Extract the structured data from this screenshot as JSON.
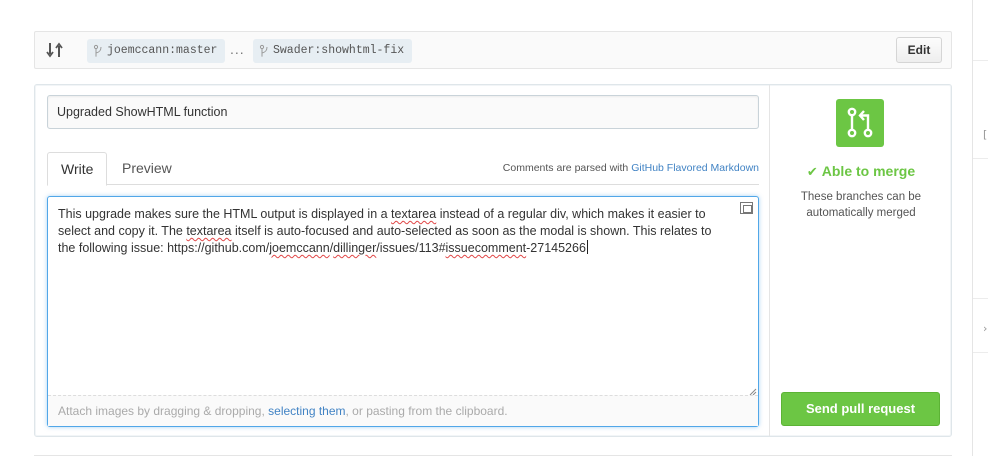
{
  "compare": {
    "base_branch": "joemccann:master",
    "separator": "...",
    "head_branch": "Swader:showhtml-fix",
    "edit_label": "Edit"
  },
  "composer": {
    "title_value": "Upgraded ShowHTML function",
    "tabs": [
      {
        "label": "Write",
        "active": true
      },
      {
        "label": "Preview",
        "active": false
      }
    ],
    "markdown_note_prefix": "Comments are parsed with",
    "markdown_link": "GitHub Flavored Markdown",
    "body_parts": [
      "This upgrade makes sure the HTML output is displayed in a ",
      "textarea",
      " instead of a regular div, which makes it easier to select and copy it. The ",
      "textarea",
      " itself is auto-focused and auto-selected as soon as the modal is shown. This relates to the following issue: https://github.com/",
      "joemccann",
      "/",
      "dillinger",
      "/issues/113#",
      "issuecomment",
      "-27145266"
    ],
    "attach_prefix": "Attach images by dragging & dropping, ",
    "attach_link": "selecting them",
    "attach_suffix": ", or pasting from the clipboard."
  },
  "merge": {
    "status": "Able to merge",
    "description": "These branches can be automatically merged",
    "send_label": "Send pull request"
  },
  "colors": {
    "accent_green": "#6cc644",
    "link_blue": "#4183c4",
    "focus_blue": "#51a7e8"
  },
  "icons": [
    "compare-icon",
    "branch-icon",
    "fullscreen-icon",
    "merge-icon",
    "check-icon",
    "resize-grip-icon"
  ]
}
